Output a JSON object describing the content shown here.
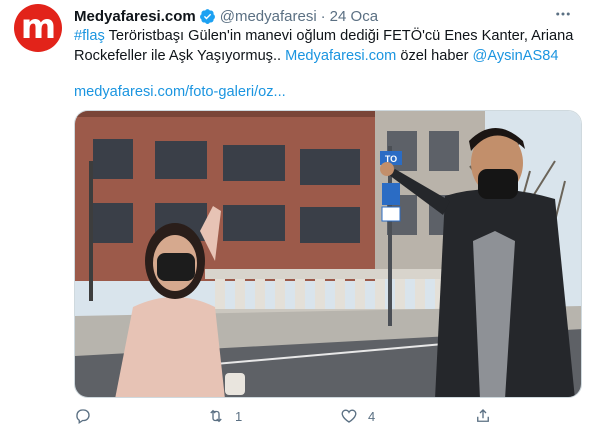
{
  "author": {
    "display_name": "Medyafaresi.com",
    "handle": "@medyafaresi",
    "separator": "·",
    "time": "24 Oca",
    "avatar_letter": "m",
    "avatar_color": "#e2231a",
    "verified_color": "#1da1f2"
  },
  "tweet": {
    "hashtag": "#flaş",
    "text_main": " Teröristbaşı Gülen'in manevi oğlum dediği FETÖ'cü Enes Kanter, Ariana Rockefeller ile Aşk Yaşıyormuş.. ",
    "site_link": "Medyafaresi.com",
    "text_mid": " özel haber ",
    "mention": "@AysinAS84",
    "url": "medyafaresi.com/foto-galeri/oz..."
  },
  "media": {
    "sign_text": "TO"
  },
  "actions": {
    "reply_count": "",
    "retweet_count": "1",
    "like_count": "4",
    "share_count": ""
  },
  "colors": {
    "link": "#1b95e0",
    "muted": "#5b7083"
  }
}
